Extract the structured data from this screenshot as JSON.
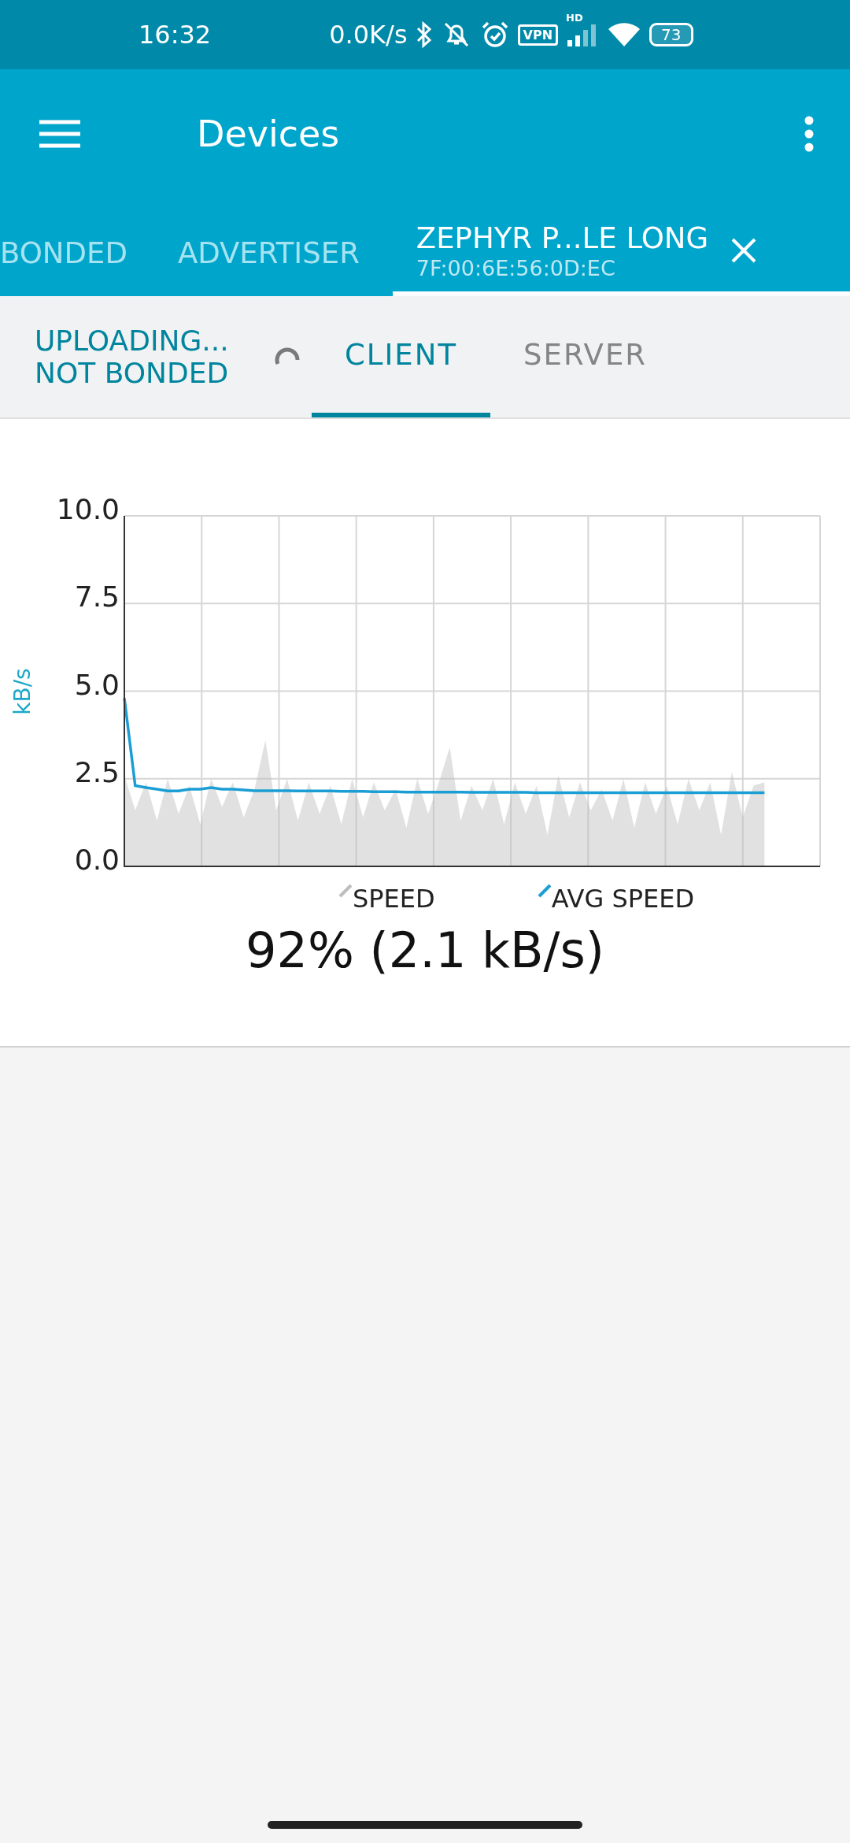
{
  "status_bar": {
    "time": "16:32",
    "net_speed": "0.0K/s",
    "vpn": "VPN",
    "hd": "HD",
    "battery": "73"
  },
  "app_bar": {
    "title": "Devices"
  },
  "device_tabs": [
    {
      "label": "BONDED",
      "selected": false
    },
    {
      "label": "ADVERTISER",
      "selected": false
    },
    {
      "label": "ZEPHYR P...LE LONG",
      "address": "7F:00:6E:56:0D:EC",
      "selected": true,
      "closable": true
    }
  ],
  "connection": {
    "state": "UPLOADING...",
    "bond": "NOT BONDED",
    "busy": true
  },
  "role_tabs": [
    {
      "label": "CLIENT",
      "selected": true
    },
    {
      "label": "SERVER",
      "selected": false
    }
  ],
  "throughput": {
    "chart_data": {
      "type": "area",
      "ylabel": "kB/s",
      "ylim": [
        0,
        10
      ],
      "grid": true,
      "yticks": [
        {
          "value": 0,
          "label": "0.0"
        },
        {
          "value": 2.5,
          "label": "2.5"
        },
        {
          "value": 5,
          "label": "5.0"
        },
        {
          "value": 7.5,
          "label": "7.5"
        },
        {
          "value": 10,
          "label": "10.0"
        }
      ],
      "series": [
        {
          "name": "SPEED",
          "color": "#bdbdbd",
          "values": [
            2.6,
            1.6,
            2.4,
            1.3,
            2.5,
            1.5,
            2.3,
            1.2,
            2.5,
            1.7,
            2.4,
            1.4,
            2.2,
            3.6,
            1.6,
            2.5,
            1.3,
            2.4,
            1.5,
            2.3,
            1.2,
            2.5,
            1.4,
            2.4,
            1.6,
            2.2,
            1.1,
            2.5,
            1.5,
            2.4,
            3.4,
            1.3,
            2.3,
            1.6,
            2.5,
            1.2,
            2.4,
            1.5,
            2.3,
            0.9,
            2.6,
            1.4,
            2.4,
            1.6,
            2.2,
            1.3,
            2.5,
            1.1,
            2.4,
            1.5,
            2.3,
            1.2,
            2.5,
            1.6,
            2.4,
            0.9,
            2.7,
            1.4,
            2.3,
            2.4
          ]
        },
        {
          "name": "AVG SPEED",
          "type": "line",
          "color": "#1a9ed4",
          "values": [
            4.8,
            2.3,
            2.25,
            2.2,
            2.15,
            2.15,
            2.2,
            2.2,
            2.25,
            2.2,
            2.2,
            2.18,
            2.16,
            2.16,
            2.16,
            2.16,
            2.15,
            2.15,
            2.15,
            2.15,
            2.14,
            2.14,
            2.14,
            2.13,
            2.13,
            2.13,
            2.12,
            2.12,
            2.12,
            2.12,
            2.12,
            2.12,
            2.11,
            2.11,
            2.11,
            2.11,
            2.11,
            2.11,
            2.1,
            2.1,
            2.1,
            2.1,
            2.1,
            2.1,
            2.1,
            2.1,
            2.1,
            2.1,
            2.1,
            2.1,
            2.1,
            2.1,
            2.1,
            2.1,
            2.1,
            2.1,
            2.1,
            2.1,
            2.1,
            2.1
          ]
        }
      ]
    },
    "progress": "92% (2.1 kB/s)"
  }
}
